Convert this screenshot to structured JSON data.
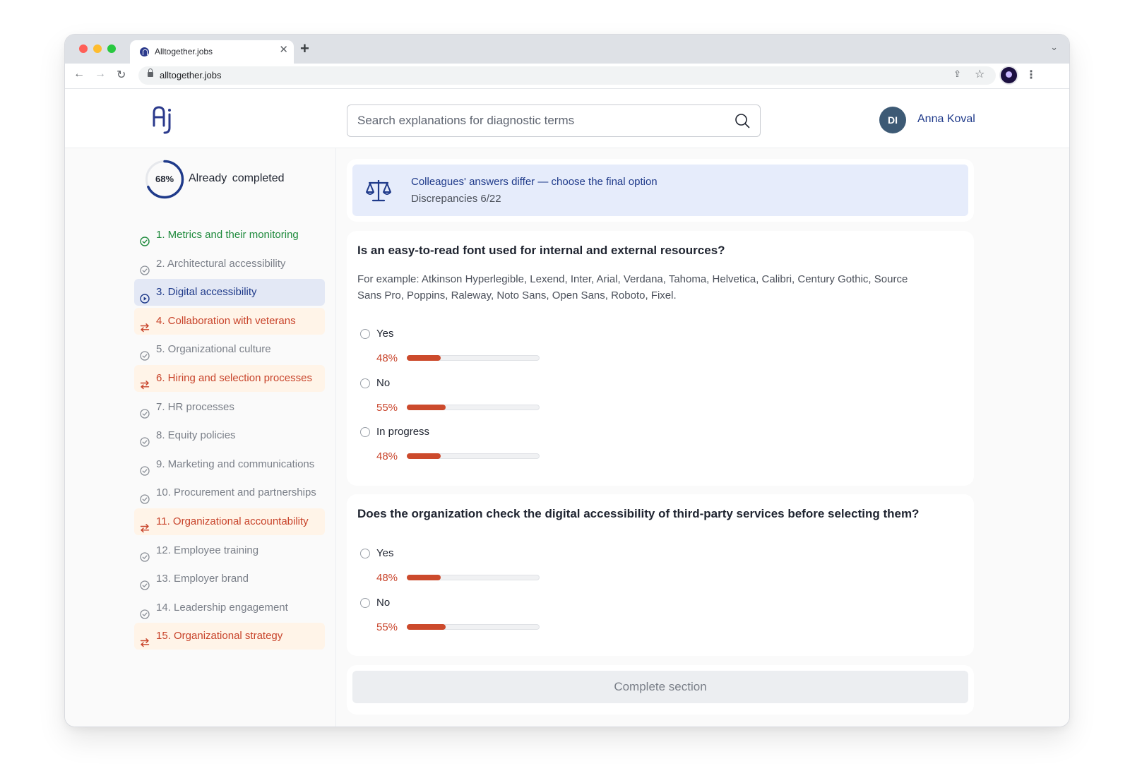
{
  "browser": {
    "tab_title": "Alltogether.jobs",
    "url": "alltogether.jobs"
  },
  "header": {
    "search_placeholder": "Search explanations for diagnostic terms",
    "avatar_initials": "DI",
    "user_name": "Anna Koval"
  },
  "progress": {
    "percent_label": "68%",
    "percent_value": 68,
    "label": "Already completed"
  },
  "sections": [
    {
      "label": "1. Metrics and their monitoring",
      "status": "done"
    },
    {
      "label": "2. Architectural accessibility",
      "status": "todo"
    },
    {
      "label": "3. Digital accessibility",
      "status": "active"
    },
    {
      "label": "4. Collaboration with veterans",
      "status": "diff"
    },
    {
      "label": "5. Organizational culture",
      "status": "todo"
    },
    {
      "label": "6. Hiring and selection processes",
      "status": "diff"
    },
    {
      "label": "7. HR processes",
      "status": "todo"
    },
    {
      "label": "8. Equity policies",
      "status": "todo"
    },
    {
      "label": "9. Marketing and communications",
      "status": "todo"
    },
    {
      "label": "10. Procurement and partnerships",
      "status": "todo"
    },
    {
      "label": "11. Organizational accountability",
      "status": "diff"
    },
    {
      "label": "12. Employee training",
      "status": "todo"
    },
    {
      "label": "13. Employer brand",
      "status": "todo"
    },
    {
      "label": "14. Leadership engagement",
      "status": "todo"
    },
    {
      "label": "15. Organizational strategy",
      "status": "diff"
    }
  ],
  "notice": {
    "title": "Colleagues' answers differ — choose the final option",
    "subtitle": "Discrepancies 6/22"
  },
  "questions": [
    {
      "title": "Is an easy-to-read font used for internal and external resources?",
      "description": "For example: Atkinson Hyperlegible, Lexend, Inter, Arial, Verdana, Tahoma, Helvetica, Calibri, Century Gothic, Source Sans Pro, Poppins, Raleway, Noto Sans, Open Sans, Roboto, Fixel.",
      "options": [
        {
          "label": "Yes",
          "percent_label": "48%",
          "percent": 48
        },
        {
          "label": "No",
          "percent_label": "55%",
          "percent": 55
        },
        {
          "label": "In progress",
          "percent_label": "48%",
          "percent": 48
        }
      ]
    },
    {
      "title": "Does the organization check the digital accessibility of third-party services before selecting them?",
      "options": [
        {
          "label": "Yes",
          "percent_label": "48%",
          "percent": 48
        },
        {
          "label": "No",
          "percent_label": "55%",
          "percent": 55
        }
      ]
    }
  ],
  "actions": {
    "complete_label": "Complete section"
  },
  "colors": {
    "accent": "#1f3a8a",
    "done": "#1e8a3c",
    "discrepancy": "#c8432a",
    "bar": "#cc4a2c",
    "notice_bg": "#e6ecfb"
  }
}
